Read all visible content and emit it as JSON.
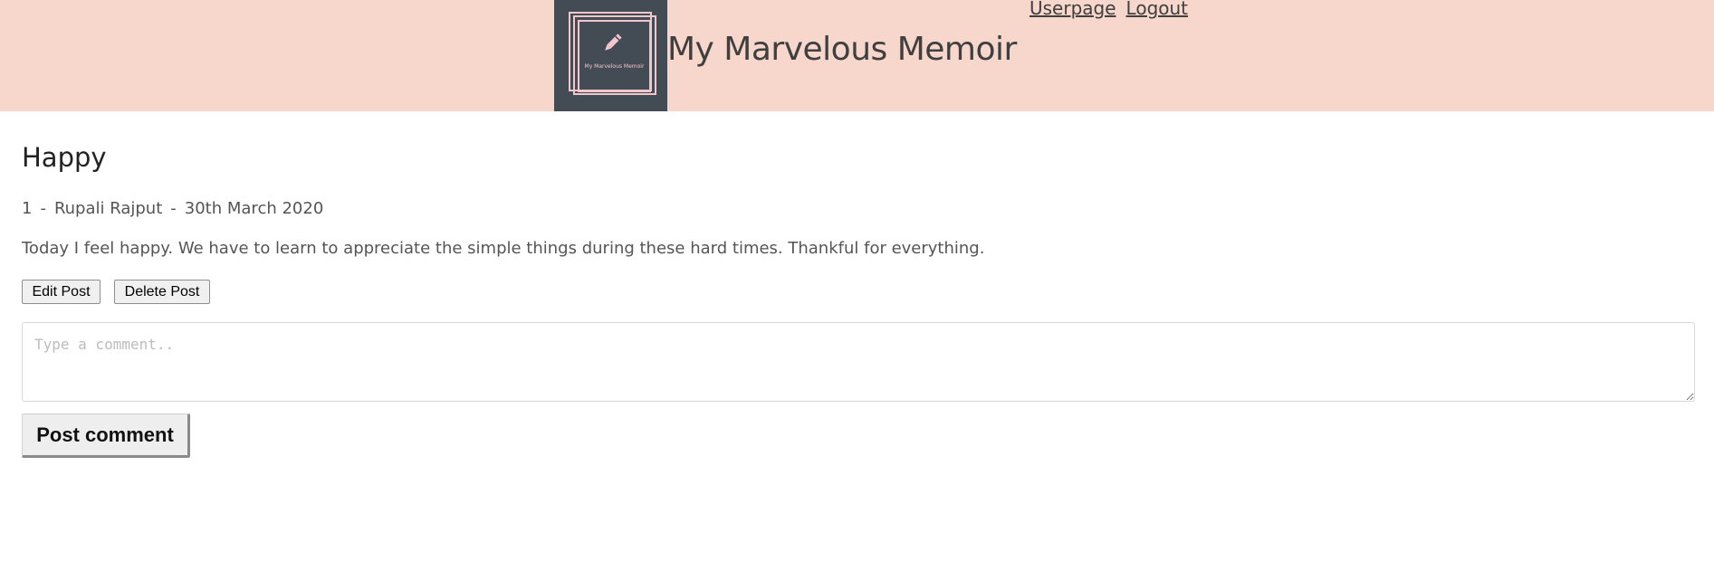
{
  "header": {
    "logo_text": "My Marvelous Memoir",
    "logo_icon": "pencil-icon",
    "site_title": "My Marvelous Memoir",
    "nav": {
      "userpage": "Userpage",
      "logout": "Logout"
    }
  },
  "post": {
    "title": "Happy",
    "id": "1",
    "separator": "-",
    "author": "Rupali Rajput",
    "date": "30th March 2020",
    "body": "Today I feel happy. We have to learn to appreciate the simple things during these hard times. Thankful for everything.",
    "edit_label": "Edit Post",
    "delete_label": "Delete Post"
  },
  "comment": {
    "placeholder": "Type a comment..",
    "value": "",
    "submit_label": "Post comment"
  },
  "colors": {
    "header_bg": "#f7d6cc",
    "logo_bg": "#434b55",
    "logo_accent": "#f2c7cc"
  }
}
